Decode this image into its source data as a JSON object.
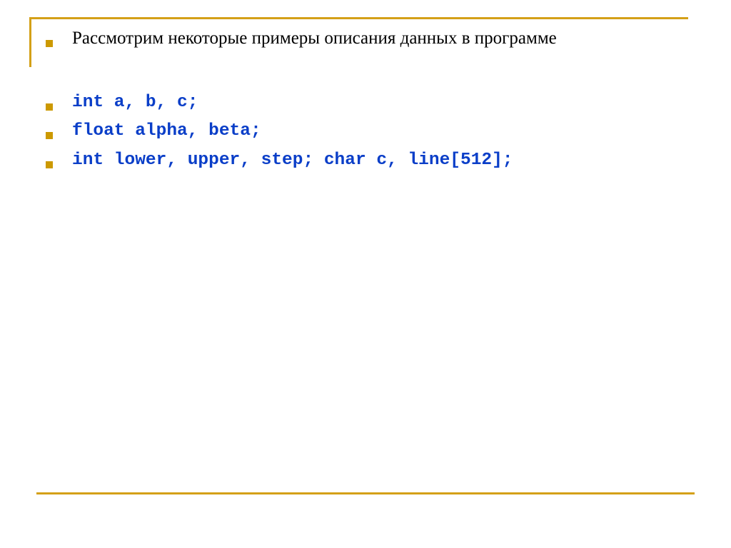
{
  "slide": {
    "accent_color": "#d4a017",
    "bullet_color": "#cc9900",
    "code_color": "#0a3ec8",
    "intro_text": "Рассмотрим некоторые примеры описания данных в программе",
    "code_lines": [
      "int a, b, c;",
      "float alpha, beta;",
      "int lower, upper, step; char c, line[512];"
    ]
  }
}
